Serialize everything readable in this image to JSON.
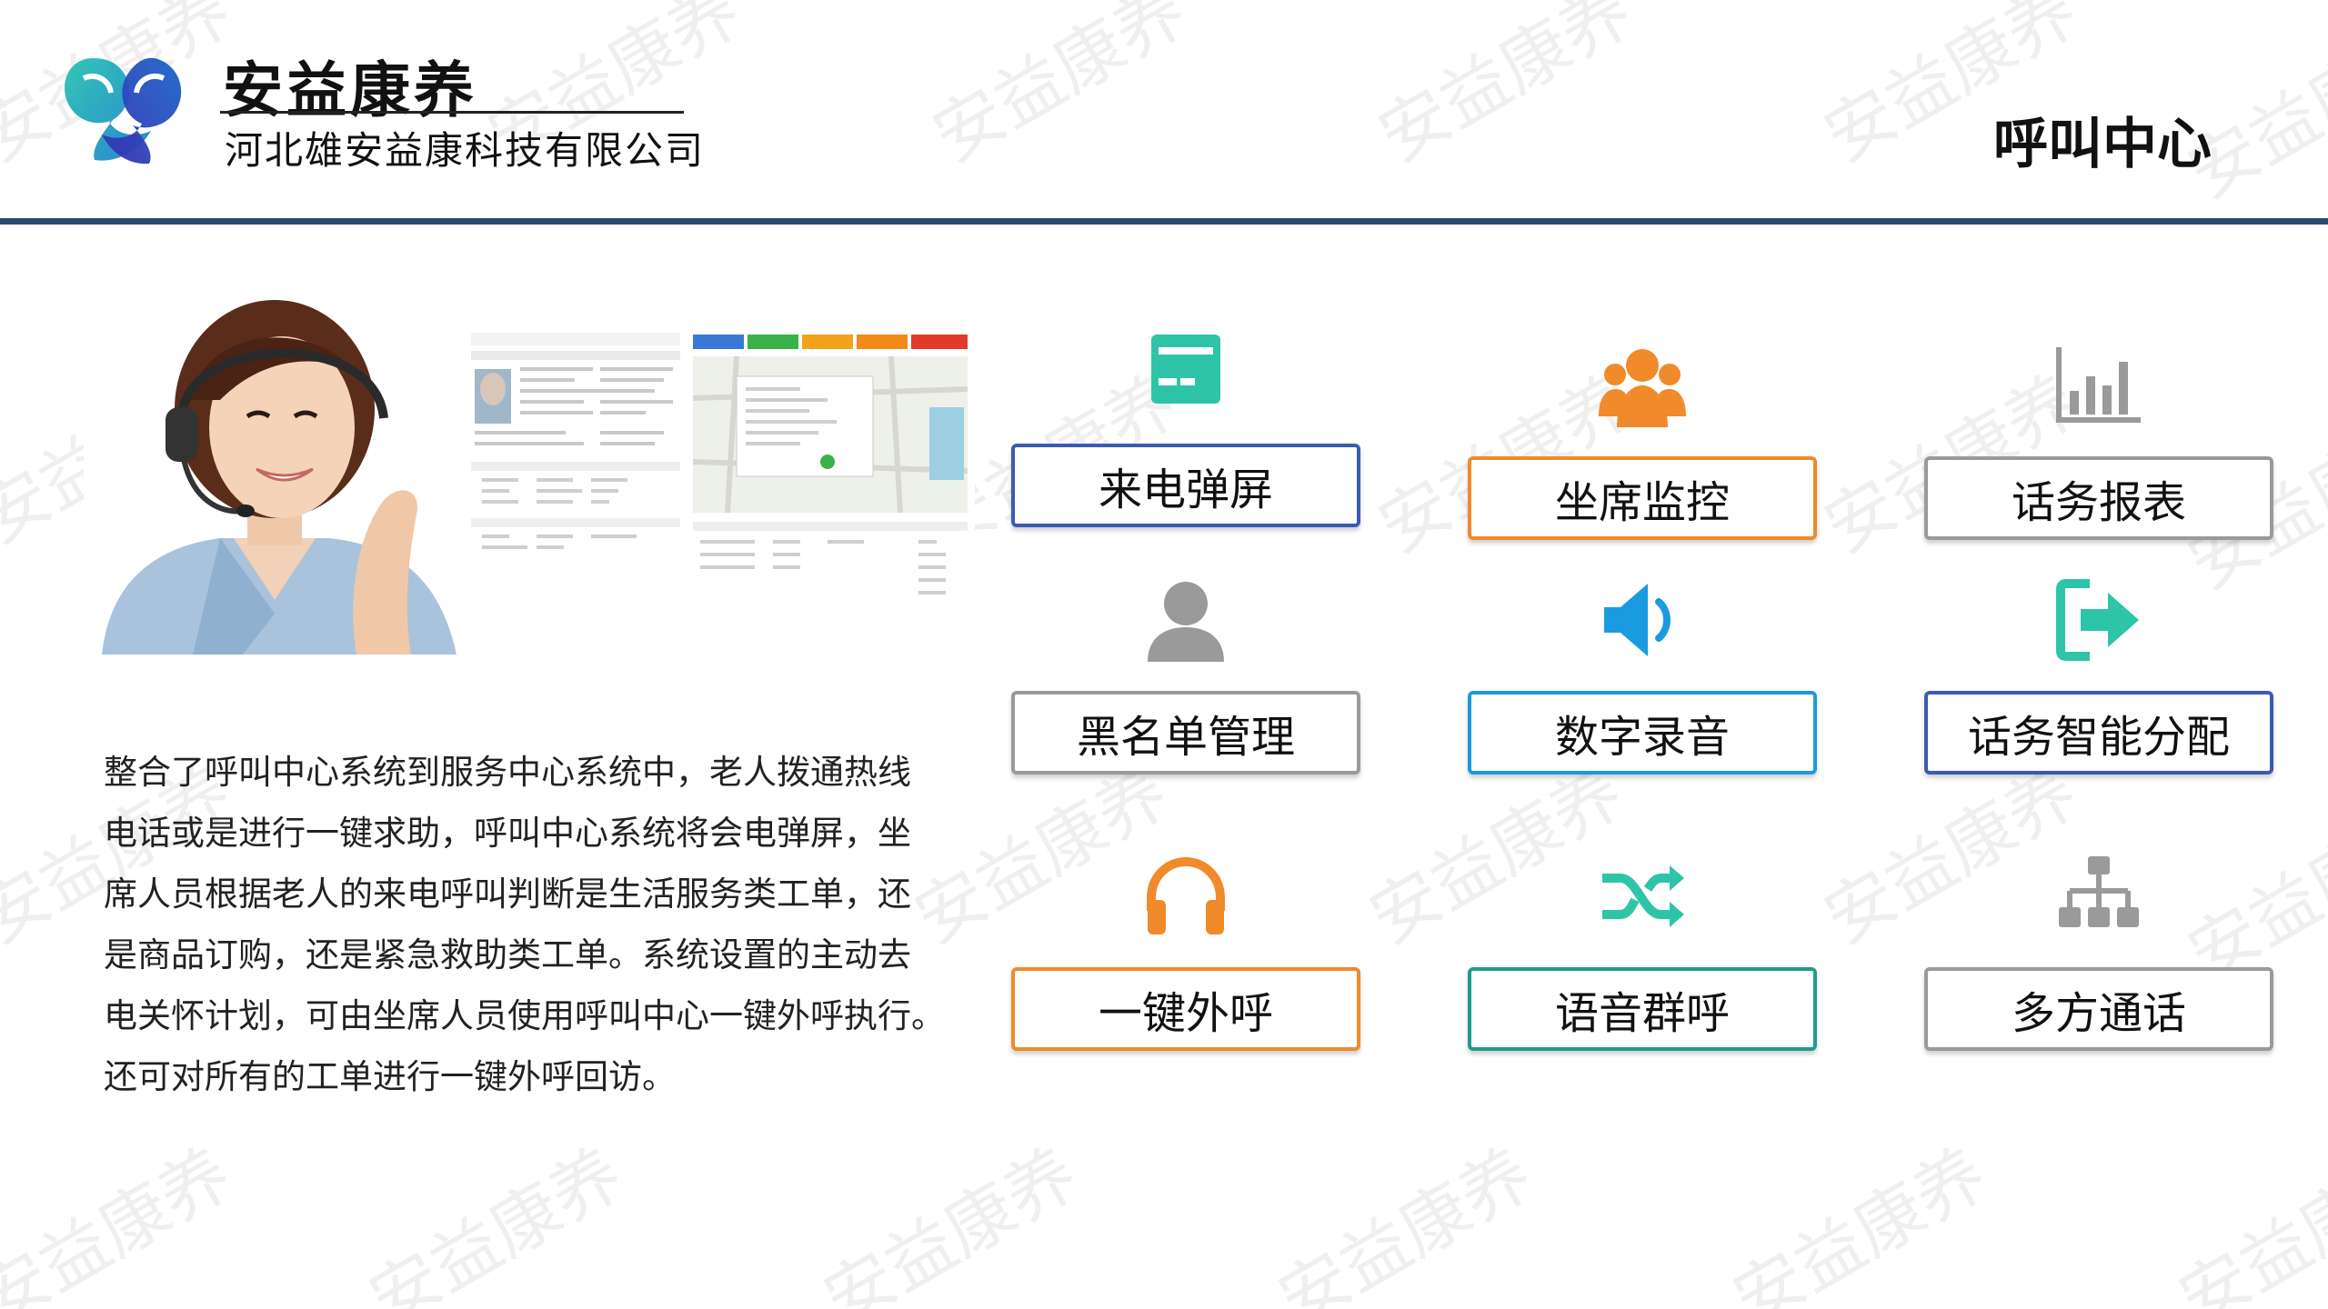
{
  "brand": {
    "name": "安益康养",
    "company": "河北雄安益康科技有限公司"
  },
  "page_title": "呼叫中心",
  "watermark": "安益康养",
  "description": [
    "整合了呼叫中心系统到服务中心系统中，老人拨通热线",
    "电话或是进行一键求助，呼叫中心系统将会电弹屏，坐",
    "席人员根据老人的来电呼叫判断是生活服务类工单，还",
    "是商品订购，还是紧急救助类工单。系统设置的主动去",
    "电关怀计划，可由坐席人员使用呼叫中心一键外呼执行。",
    "还可对所有的工单进行一键外呼回访。"
  ],
  "features": [
    {
      "label": "来电弹屏",
      "icon": "screen-popup-icon",
      "color": "#2ec4a8",
      "border": "#3a5bb5"
    },
    {
      "label": "坐席监控",
      "icon": "agents-group-icon",
      "color": "#f08a2b",
      "border": "#f08a2b"
    },
    {
      "label": "话务报表",
      "icon": "bar-chart-icon",
      "color": "#9a9a9a",
      "border": "#9a9a9a"
    },
    {
      "label": "黑名单管理",
      "icon": "user-icon",
      "color": "#9a9a9a",
      "border": "#9a9a9a"
    },
    {
      "label": "数字录音",
      "icon": "speaker-icon",
      "color": "#1a9be0",
      "border": "#1a9be0"
    },
    {
      "label": "话务智能分配",
      "icon": "sign-out-icon",
      "color": "#2ec4a8",
      "border": "#3a5bb5"
    },
    {
      "label": "一键外呼",
      "icon": "headphones-icon",
      "color": "#f08a2b",
      "border": "#f08a2b"
    },
    {
      "label": "语音群呼",
      "icon": "shuffle-icon",
      "color": "#2ec4a8",
      "border": "#1e9e8a"
    },
    {
      "label": "多方通话",
      "icon": "sitemap-icon",
      "color": "#9a9a9a",
      "border": "#9a9a9a"
    }
  ]
}
